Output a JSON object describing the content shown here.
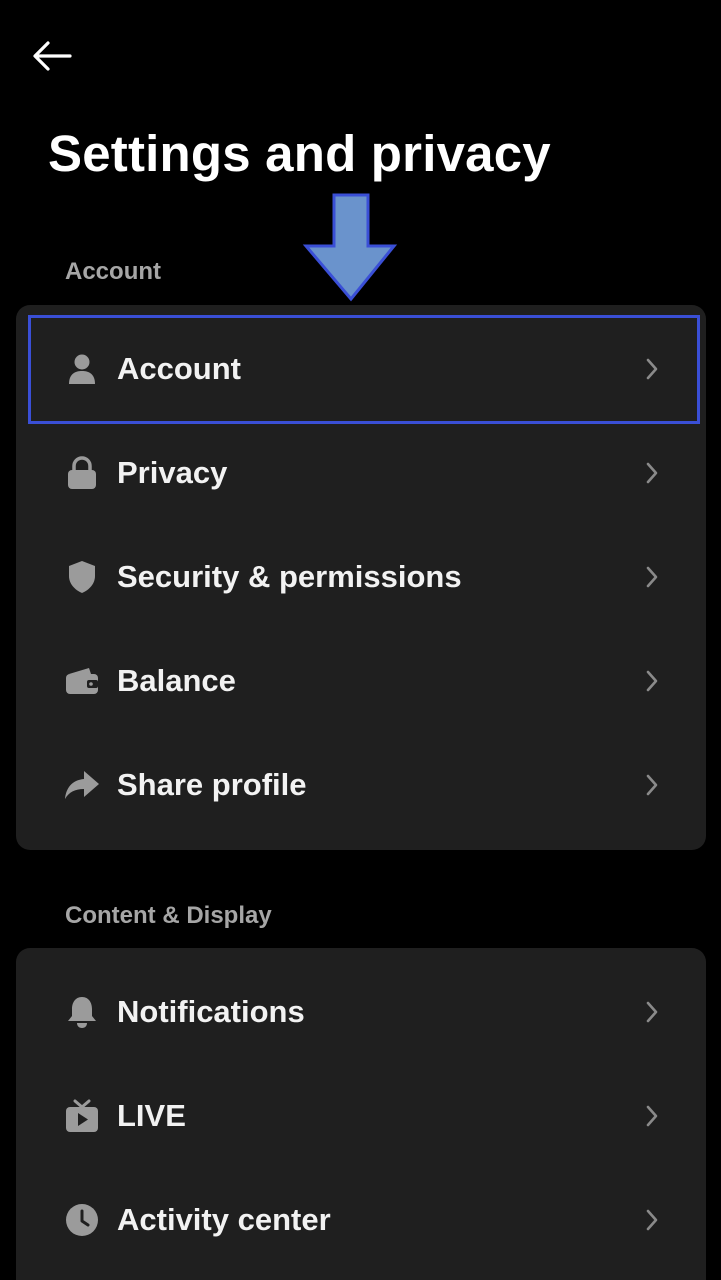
{
  "header": {
    "back_icon": "arrow-left-icon",
    "title": "Settings and privacy"
  },
  "sections": [
    {
      "label": "Account",
      "items": [
        {
          "label": "Account",
          "icon": "person-icon"
        },
        {
          "label": "Privacy",
          "icon": "lock-icon"
        },
        {
          "label": "Security & permissions",
          "icon": "shield-icon"
        },
        {
          "label": "Balance",
          "icon": "wallet-icon"
        },
        {
          "label": "Share profile",
          "icon": "share-icon"
        }
      ]
    },
    {
      "label": "Content & Display",
      "items": [
        {
          "label": "Notifications",
          "icon": "bell-icon"
        },
        {
          "label": "LIVE",
          "icon": "tv-icon"
        },
        {
          "label": "Activity center",
          "icon": "clock-icon"
        }
      ]
    }
  ],
  "colors": {
    "background": "#000000",
    "card": "#1f1f1f",
    "section_label": "#a6a6a6",
    "icon": "#9b9b9b",
    "highlight_border": "#3a4fd6",
    "annotation_arrow": "#6a93cc"
  }
}
